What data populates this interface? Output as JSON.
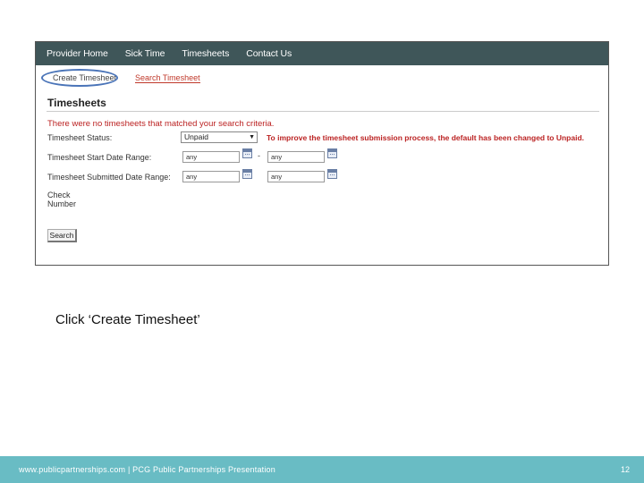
{
  "nav": {
    "items": [
      "Provider Home",
      "Sick Time",
      "Timesheets",
      "Contact Us"
    ]
  },
  "subtabs": {
    "create": "Create Timesheet",
    "search": "Search Timesheet"
  },
  "page_title": "Timesheets",
  "error_message": "There were no timesheets that matched your search criteria.",
  "form": {
    "status_label": "Timesheet Status:",
    "status_value": "Unpaid",
    "status_arrow": "▼",
    "status_notice": "To improve the timesheet submission process, the default has been changed to Unpaid.",
    "start_range_label": "Timesheet Start Date Range:",
    "start_from": "any",
    "start_to": "any",
    "range_separator": "-",
    "submitted_range_label": "Timesheet Submitted Date Range:",
    "submitted_from": "any",
    "submitted_to": "any",
    "check_number_label_1": "Check",
    "check_number_label_2": "Number",
    "search_button": "Search"
  },
  "caption": "Click ‘Create Timesheet’",
  "footer": {
    "text": "www.publicpartnerships.com | PCG Public Partnerships Presentation",
    "page_number": "12"
  },
  "colors": {
    "nav_bg": "#3f5659",
    "footer_bg": "#69bcc4",
    "error_red": "#b22222",
    "highlight_oval": "#4a74b8"
  }
}
